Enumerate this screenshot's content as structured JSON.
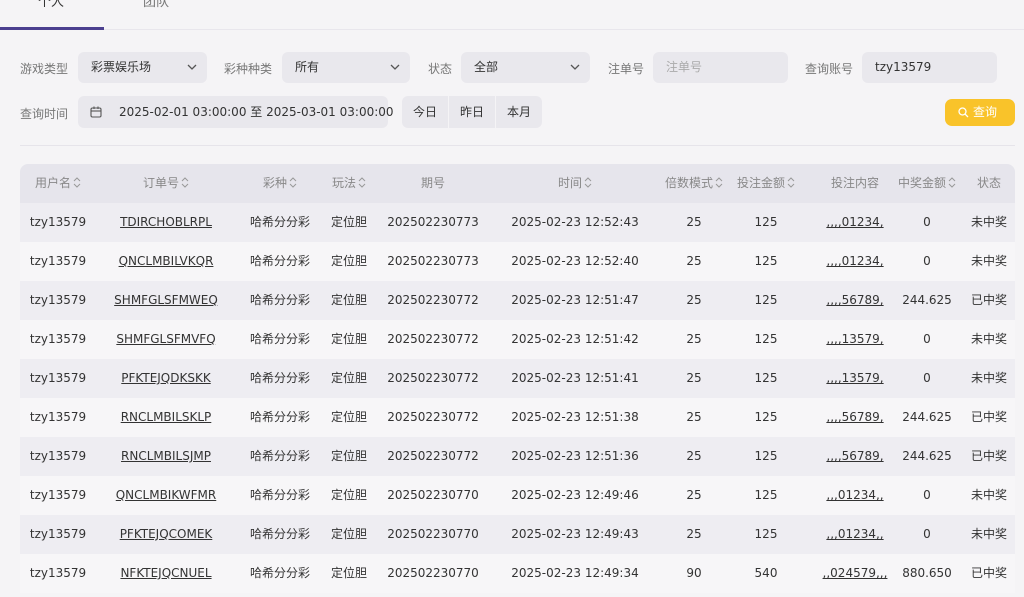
{
  "tabs": [
    {
      "label": "个人"
    },
    {
      "label": "团队"
    }
  ],
  "filters": {
    "game_type_label": "游戏类型",
    "game_type_value": "彩票娱乐场",
    "lottery_label": "彩种种类",
    "lottery_value": "所有",
    "status_label": "状态",
    "status_value": "全部",
    "order_label": "注单号",
    "order_placeholder": "注单号",
    "account_label": "查询账号",
    "account_value": "tzy13579",
    "time_label": "查询时间",
    "date_range": "2025-02-01 03:00:00 至 2025-03-01 03:00:00",
    "quick": [
      "今日",
      "昨日",
      "本月"
    ],
    "search_label": "查询"
  },
  "table": {
    "headers": [
      "用户名",
      "订单号",
      "彩种",
      "玩法",
      "期号",
      "时间",
      "倍数模式",
      "投注金额",
      "投注内容",
      "中奖金额",
      "状态"
    ],
    "rows": [
      [
        "tzy13579",
        "TDIRCHOBLRPL",
        "哈希分分彩",
        "定位胆",
        "202502230773",
        "2025-02-23 12:52:43",
        "25",
        "125",
        ",,,,01234,",
        "0",
        "未中奖"
      ],
      [
        "tzy13579",
        "QNCLMBILVKQR",
        "哈希分分彩",
        "定位胆",
        "202502230773",
        "2025-02-23 12:52:40",
        "25",
        "125",
        ",,,,01234,",
        "0",
        "未中奖"
      ],
      [
        "tzy13579",
        "SHMFGLSFMWEQ",
        "哈希分分彩",
        "定位胆",
        "202502230772",
        "2025-02-23 12:51:47",
        "25",
        "125",
        ",,,,56789,",
        "244.625",
        "已中奖"
      ],
      [
        "tzy13579",
        "SHMFGLSFMVFQ",
        "哈希分分彩",
        "定位胆",
        "202502230772",
        "2025-02-23 12:51:42",
        "25",
        "125",
        ",,,,13579,",
        "0",
        "未中奖"
      ],
      [
        "tzy13579",
        "PFKTEJQDKSKK",
        "哈希分分彩",
        "定位胆",
        "202502230772",
        "2025-02-23 12:51:41",
        "25",
        "125",
        ",,,,13579,",
        "0",
        "未中奖"
      ],
      [
        "tzy13579",
        "RNCLMBILSKLP",
        "哈希分分彩",
        "定位胆",
        "202502230772",
        "2025-02-23 12:51:38",
        "25",
        "125",
        ",,,,56789,",
        "244.625",
        "已中奖"
      ],
      [
        "tzy13579",
        "RNCLMBILSJMP",
        "哈希分分彩",
        "定位胆",
        "202502230772",
        "2025-02-23 12:51:36",
        "25",
        "125",
        ",,,,56789,",
        "244.625",
        "已中奖"
      ],
      [
        "tzy13579",
        "QNCLMBIKWFMR",
        "哈希分分彩",
        "定位胆",
        "202502230770",
        "2025-02-23 12:49:46",
        "25",
        "125",
        ",,,01234,,",
        "0",
        "未中奖"
      ],
      [
        "tzy13579",
        "PFKTEJQCOMEK",
        "哈希分分彩",
        "定位胆",
        "202502230770",
        "2025-02-23 12:49:43",
        "25",
        "125",
        ",,,01234,,",
        "0",
        "未中奖"
      ],
      [
        "tzy13579",
        "NFKTEJQCNUEL",
        "哈希分分彩",
        "定位胆",
        "202502230770",
        "2025-02-23 12:49:34",
        "90",
        "540",
        ",,024579,,,",
        "880.650",
        "已中奖"
      ]
    ]
  },
  "colors": {
    "accent": "#4b3f8f",
    "search_button": "#f9c32a",
    "background": "#f5f4f6"
  }
}
